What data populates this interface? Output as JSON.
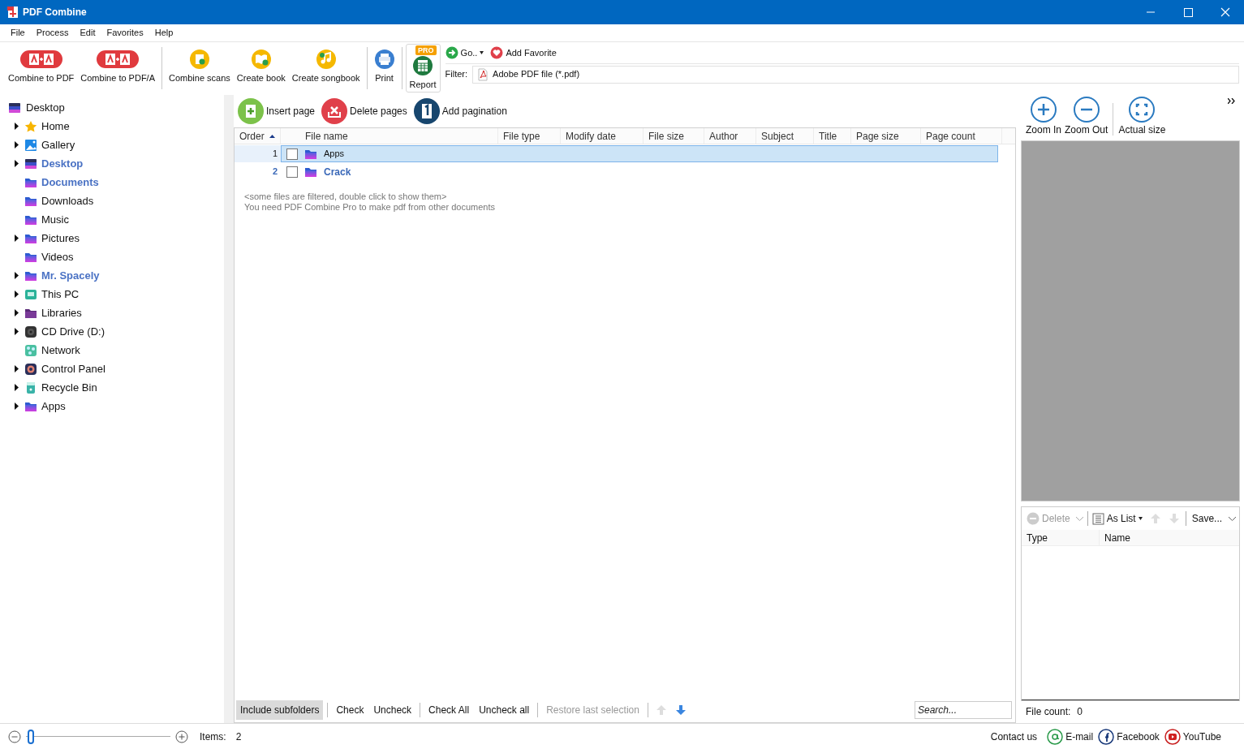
{
  "window": {
    "title": "PDF Combine"
  },
  "menu": [
    "File",
    "Process",
    "Edit",
    "Favorites",
    "Help"
  ],
  "toolbar": {
    "buttons": [
      {
        "label": "Combine to PDF",
        "kind": "combine"
      },
      {
        "label": "Combine to PDF/A",
        "kind": "combine"
      },
      {
        "label": "Combine scans",
        "kind": "scans"
      },
      {
        "label": "Create book",
        "kind": "book"
      },
      {
        "label": "Create songbook",
        "kind": "song"
      },
      {
        "label": "Print",
        "kind": "print"
      },
      {
        "label": "Report",
        "kind": "report",
        "badge": "PRO"
      }
    ],
    "go": "Go..",
    "add_favorite": "Add Favorite",
    "filter_label": "Filter:",
    "filter_value": "Adobe PDF file (*.pdf)"
  },
  "tree": {
    "label": "Desktop",
    "children": [
      {
        "label": "Home",
        "kind": "star",
        "has_children": true,
        "highlighted": false
      },
      {
        "label": "Gallery",
        "kind": "gallery",
        "has_children": true,
        "highlighted": false
      },
      {
        "label": "Desktop",
        "kind": "desktop",
        "has_children": true,
        "highlighted": true
      },
      {
        "label": "Documents",
        "kind": "folder",
        "has_children": false,
        "highlighted": true
      },
      {
        "label": "Downloads",
        "kind": "folder",
        "has_children": false,
        "highlighted": false
      },
      {
        "label": "Music",
        "kind": "folder",
        "has_children": false,
        "highlighted": false
      },
      {
        "label": "Pictures",
        "kind": "folder",
        "has_children": true,
        "highlighted": false
      },
      {
        "label": "Videos",
        "kind": "folder",
        "has_children": false,
        "highlighted": false
      },
      {
        "label": "Mr. Spacely",
        "kind": "folder",
        "has_children": true,
        "highlighted": true
      },
      {
        "label": "This PC",
        "kind": "pc",
        "has_children": true,
        "highlighted": false
      },
      {
        "label": "Libraries",
        "kind": "library",
        "has_children": true,
        "highlighted": false
      },
      {
        "label": "CD Drive (D:)",
        "kind": "drive",
        "has_children": true,
        "highlighted": false
      },
      {
        "label": "Network",
        "kind": "network",
        "has_children": false,
        "highlighted": false
      },
      {
        "label": "Control Panel",
        "kind": "panel",
        "has_children": true,
        "highlighted": false
      },
      {
        "label": "Recycle Bin",
        "kind": "bin",
        "has_children": true,
        "highlighted": false
      },
      {
        "label": "Apps",
        "kind": "folder",
        "has_children": true,
        "highlighted": false
      }
    ]
  },
  "actions": [
    {
      "label": "Insert page",
      "kind": "insert"
    },
    {
      "label": "Delete pages",
      "kind": "delete"
    },
    {
      "label": "Add pagination",
      "kind": "paginate"
    }
  ],
  "table": {
    "columns": [
      "Order",
      "File name",
      "File type",
      "Modify date",
      "File size",
      "Author",
      "Subject",
      "Title",
      "Page size",
      "Page count"
    ],
    "rows": [
      {
        "order": "1",
        "name": "Apps",
        "checked": false,
        "selected": true,
        "highlighted": false
      },
      {
        "order": "2",
        "name": "Crack",
        "checked": false,
        "selected": false,
        "highlighted": true
      }
    ],
    "notes": [
      "<some files are filtered, double click to show them>",
      "You need PDF Combine Pro to make pdf from other documents"
    ]
  },
  "bottom_bar": {
    "buttons": [
      {
        "label": "Include subfolders",
        "selected": true,
        "disabled": false
      },
      {
        "label": "Check",
        "selected": false,
        "disabled": false
      },
      {
        "label": "Uncheck",
        "selected": false,
        "disabled": false
      },
      {
        "label": "Check All",
        "selected": false,
        "disabled": false
      },
      {
        "label": "Uncheck all",
        "selected": false,
        "disabled": false
      },
      {
        "label": "Restore last selection",
        "selected": false,
        "disabled": true
      }
    ],
    "search_placeholder": "Search..."
  },
  "preview": {
    "buttons": [
      {
        "label": "Zoom In",
        "kind": "plus"
      },
      {
        "label": "Zoom Out",
        "kind": "minus"
      },
      {
        "label": "Actual size",
        "kind": "fit"
      }
    ]
  },
  "list_panel": {
    "delete": "Delete",
    "as_list": "As List",
    "save": "Save...",
    "columns": [
      "Type",
      "Name"
    ],
    "file_count_label": "File count:",
    "file_count": "0"
  },
  "status_bar": {
    "zoom": {
      "level": 0
    },
    "items_label": "Items:",
    "items": "2",
    "contact": "Contact us",
    "links": [
      {
        "label": "E-mail",
        "kind": "email"
      },
      {
        "label": "Facebook",
        "kind": "facebook"
      },
      {
        "label": "YouTube",
        "kind": "youtube"
      }
    ]
  }
}
